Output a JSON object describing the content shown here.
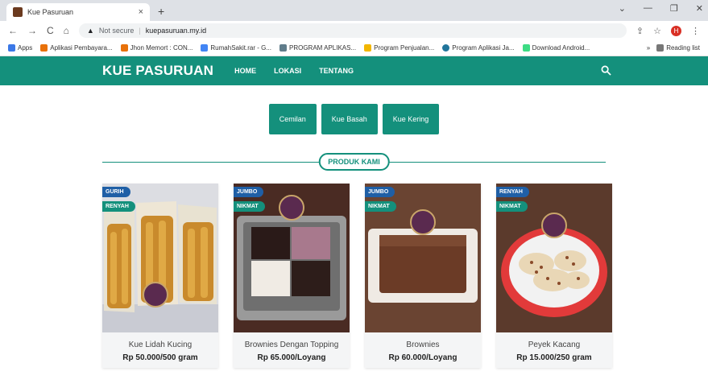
{
  "browser": {
    "tab_title": "Kue Pasuruan",
    "tab_close": "×",
    "new_tab": "+",
    "security": "Not secure",
    "url": "kuepasuruan.my.id",
    "profile_initial": "H",
    "bookmarks": [
      {
        "label": "Apps",
        "color": "#3b78e7"
      },
      {
        "label": "Aplikasi Pembayara...",
        "color": "#e8710a"
      },
      {
        "label": "Jhon Memort : CON...",
        "color": "#e8710a"
      },
      {
        "label": "RumahSakit.rar - G...",
        "color": "#4285f4"
      },
      {
        "label": "PROGRAM APLIKAS...",
        "color": "#607d8b"
      },
      {
        "label": "Program Penjualan...",
        "color": "#f2b600"
      },
      {
        "label": "Program Aplikasi Ja...",
        "color": "#21759b"
      },
      {
        "label": "Download Android...",
        "color": "#3ddc84"
      }
    ],
    "bookmarks_more": "»",
    "reading_list": "Reading list"
  },
  "site": {
    "brand": "KUE PASURUAN",
    "nav": [
      "HOME",
      "LOKASI",
      "TENTANG"
    ],
    "categories": [
      "Cemilan",
      "Kue Basah",
      "Kue Kering"
    ],
    "section_title": "PRODUK KAMI",
    "accent": "#14907c"
  },
  "products": [
    {
      "name": "Kue Lidah Kucing",
      "price": "Rp 50.000/500 gram",
      "badges": [
        "GURIH",
        "RENYAH"
      ]
    },
    {
      "name": "Brownies Dengan Topping",
      "price": "Rp 65.000/Loyang",
      "badges": [
        "JUMBO",
        "NIKMAT"
      ]
    },
    {
      "name": "Brownies",
      "price": "Rp 60.000/Loyang",
      "badges": [
        "JUMBO",
        "NIKMAT"
      ]
    },
    {
      "name": "Peyek Kacang",
      "price": "Rp 15.000/250 gram",
      "badges": [
        "RENYAH",
        "NIKMAT"
      ]
    }
  ]
}
